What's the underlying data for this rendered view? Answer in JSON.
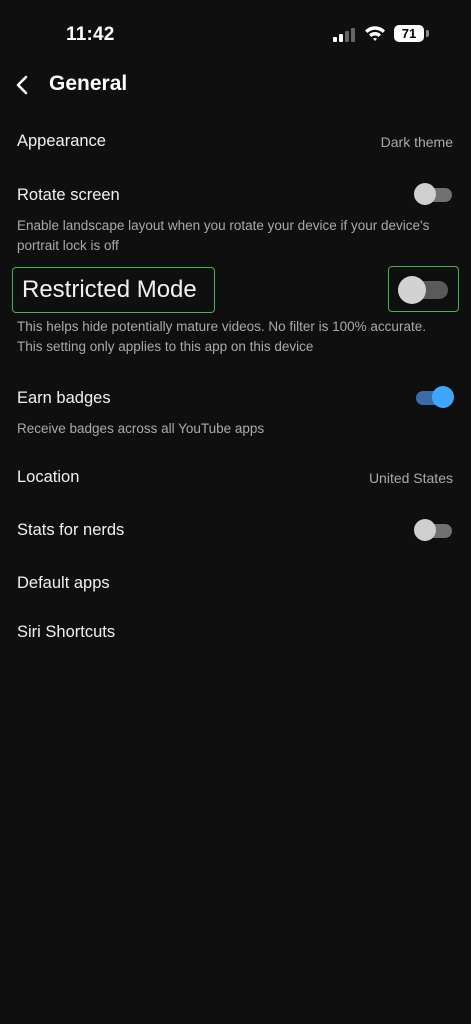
{
  "status_bar": {
    "time": "11:42",
    "battery": "71"
  },
  "header": {
    "title": "General"
  },
  "settings": {
    "appearance": {
      "title": "Appearance",
      "value": "Dark theme"
    },
    "rotate_screen": {
      "title": "Rotate screen",
      "description": "Enable landscape layout when you rotate your device if your device's portrait lock is off",
      "enabled": false
    },
    "restricted_mode": {
      "title": "Restricted Mode",
      "description": "This helps hide potentially mature videos. No filter is 100% accurate. This setting only applies to this app on this device",
      "enabled": false
    },
    "earn_badges": {
      "title": "Earn badges",
      "description": "Receive badges across all YouTube apps",
      "enabled": true
    },
    "location": {
      "title": "Location",
      "value": "United States"
    },
    "stats_for_nerds": {
      "title": "Stats for nerds",
      "enabled": false
    },
    "default_apps": {
      "title": "Default apps"
    },
    "siri_shortcuts": {
      "title": "Siri Shortcuts"
    }
  },
  "colors": {
    "background": "#0f0f0f",
    "accent": "#3ea6ff",
    "highlight": "#4caf50"
  },
  "icons": {
    "back": "chevron-left-icon",
    "signal": "cellular-signal-icon",
    "wifi": "wifi-icon",
    "battery": "battery-icon"
  }
}
